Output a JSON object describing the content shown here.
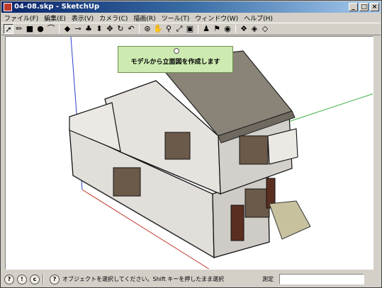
{
  "window": {
    "title": "04-08.skp - SketchUp"
  },
  "menu": [
    "ファイル(F)",
    "編集(E)",
    "表示(V)",
    "カメラ(C)",
    "描画(R)",
    "ツール(T)",
    "ウィンドウ(W)",
    "ヘルプ(H)"
  ],
  "toolbar": {
    "tools": [
      {
        "name": "select-icon",
        "glyph": "➚"
      },
      {
        "name": "pencil-icon",
        "glyph": "✏"
      },
      {
        "name": "rectangle-icon",
        "glyph": "■"
      },
      {
        "name": "circle-icon",
        "glyph": "●"
      },
      {
        "name": "arc-icon",
        "glyph": "⌒"
      },
      {
        "name": "eraser-icon",
        "glyph": "◆"
      },
      {
        "name": "tape-measure-icon",
        "glyph": "⊸"
      },
      {
        "name": "paint-bucket-icon",
        "glyph": "♣"
      },
      {
        "name": "push-pull-icon",
        "glyph": "⬍"
      },
      {
        "name": "move-icon",
        "glyph": "✥"
      },
      {
        "name": "rotate-icon",
        "glyph": "↻"
      },
      {
        "name": "offset-icon",
        "glyph": "↶"
      },
      {
        "name": "orbit-icon",
        "glyph": "⊛"
      },
      {
        "name": "pan-icon",
        "glyph": "✋"
      },
      {
        "name": "zoom-icon",
        "glyph": "⚲"
      },
      {
        "name": "zoom-extents-icon",
        "glyph": "⤢"
      },
      {
        "name": "previous-view-icon",
        "glyph": "▣"
      },
      {
        "name": "position-camera-icon",
        "glyph": "♟"
      },
      {
        "name": "walk-icon",
        "glyph": "⚑"
      },
      {
        "name": "look-around-icon",
        "glyph": "◉"
      },
      {
        "name": "components-icon",
        "glyph": "❖"
      },
      {
        "name": "materials-icon",
        "glyph": "◈"
      },
      {
        "name": "section-plane-icon",
        "glyph": "◇"
      }
    ]
  },
  "tooltip": {
    "text": "モデルから立面図を作成します"
  },
  "status": {
    "text": "オブジェクトを選択してください。Shift キーを押したまま選択",
    "measure_label": "測定",
    "measure_value": "",
    "icons": [
      "geo-location-icon",
      "credits-icon",
      "user-icon",
      "help-icon"
    ]
  },
  "colors": {
    "roof": "#8a8378",
    "wall": "#e7e4e0",
    "green_axis": "#3cb043",
    "red_axis": "#c0392b",
    "blue_axis": "#2b3fc9",
    "tooltip_bg": "#cdeab1"
  }
}
